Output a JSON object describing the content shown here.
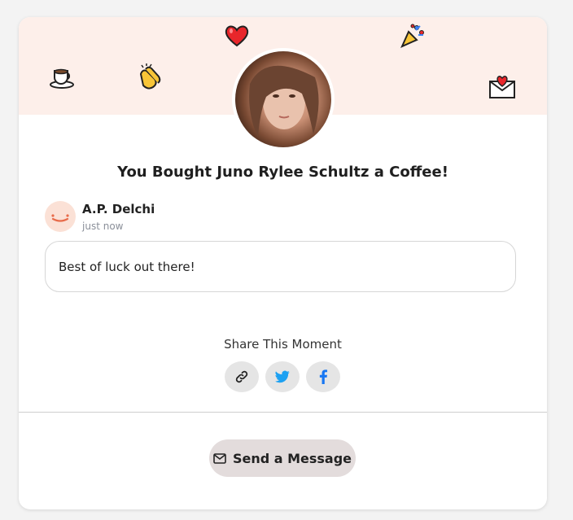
{
  "header": {
    "emojis": [
      "coffee-icon",
      "clapping-hands-icon",
      "heart-icon",
      "party-popper-icon",
      "love-letter-icon"
    ]
  },
  "title": "You Bought Juno Rylee Schultz a Coffee!",
  "supporter": {
    "name": "A.P. Delchi",
    "time": "just now"
  },
  "message": "Best of luck out there!",
  "share": {
    "label": "Share This Moment",
    "buttons": [
      "link-icon",
      "twitter-icon",
      "facebook-icon"
    ]
  },
  "send_button": {
    "label": "Send a Message"
  },
  "colors": {
    "banner": "#fdefea",
    "twitter": "#1da1f2",
    "facebook": "#1877f2",
    "send_button_bg": "#e3dcdc"
  }
}
